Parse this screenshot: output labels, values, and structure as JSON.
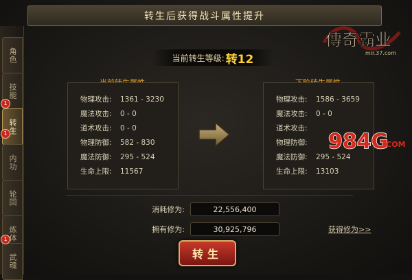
{
  "window": {
    "title": "转生后获得战斗属性提升"
  },
  "logo": {
    "main": "傳奇霸业",
    "sub": "mir.37.com"
  },
  "side_tabs": [
    {
      "label": "角色",
      "badge": null,
      "active": false
    },
    {
      "label": "技能",
      "badge": null,
      "active": false
    },
    {
      "label": "转生",
      "badge": "1",
      "active": true
    },
    {
      "label": "内功",
      "badge": "1",
      "active": false
    },
    {
      "label": "轮回",
      "badge": null,
      "active": false
    },
    {
      "label": "炼体",
      "badge": null,
      "active": false
    },
    {
      "label": "武魂",
      "badge": "1",
      "active": false
    }
  ],
  "current_level": {
    "label": "当前转生等级:",
    "value": "转12"
  },
  "current": {
    "title": "当前转生属性",
    "stats": [
      {
        "name": "物理攻击:",
        "value": "1361 - 3230"
      },
      {
        "name": "魔法攻击:",
        "value": "0 - 0"
      },
      {
        "name": "道术攻击:",
        "value": "0 - 0"
      },
      {
        "name": "物理防御:",
        "value": "582 - 830"
      },
      {
        "name": "魔法防御:",
        "value": "295 - 524"
      },
      {
        "name": "生命上限:",
        "value": "11567"
      }
    ]
  },
  "next": {
    "title": "下阶转生属性",
    "stats": [
      {
        "name": "物理攻击:",
        "value": "1586 - 3659"
      },
      {
        "name": "魔法攻击:",
        "value": "0 - 0"
      },
      {
        "name": "道术攻击:",
        "value": ""
      },
      {
        "name": "物理防御:",
        "value": ""
      },
      {
        "name": "魔法防御:",
        "value": "295 - 524"
      },
      {
        "name": "生命上限:",
        "value": "13103"
      }
    ]
  },
  "resources": {
    "cost_label": "消耗修为:",
    "cost_value": "22,556,400",
    "owned_label": "拥有修为:",
    "owned_value": "30,925,796",
    "gain_link": "获得修为>>"
  },
  "button": {
    "label": "转生"
  },
  "watermark": {
    "text": "984G",
    "suffix": ".COM"
  },
  "colors": {
    "accent": "#ffd23a",
    "panel_title": "#f0a01c",
    "button": "#b32a1d"
  }
}
